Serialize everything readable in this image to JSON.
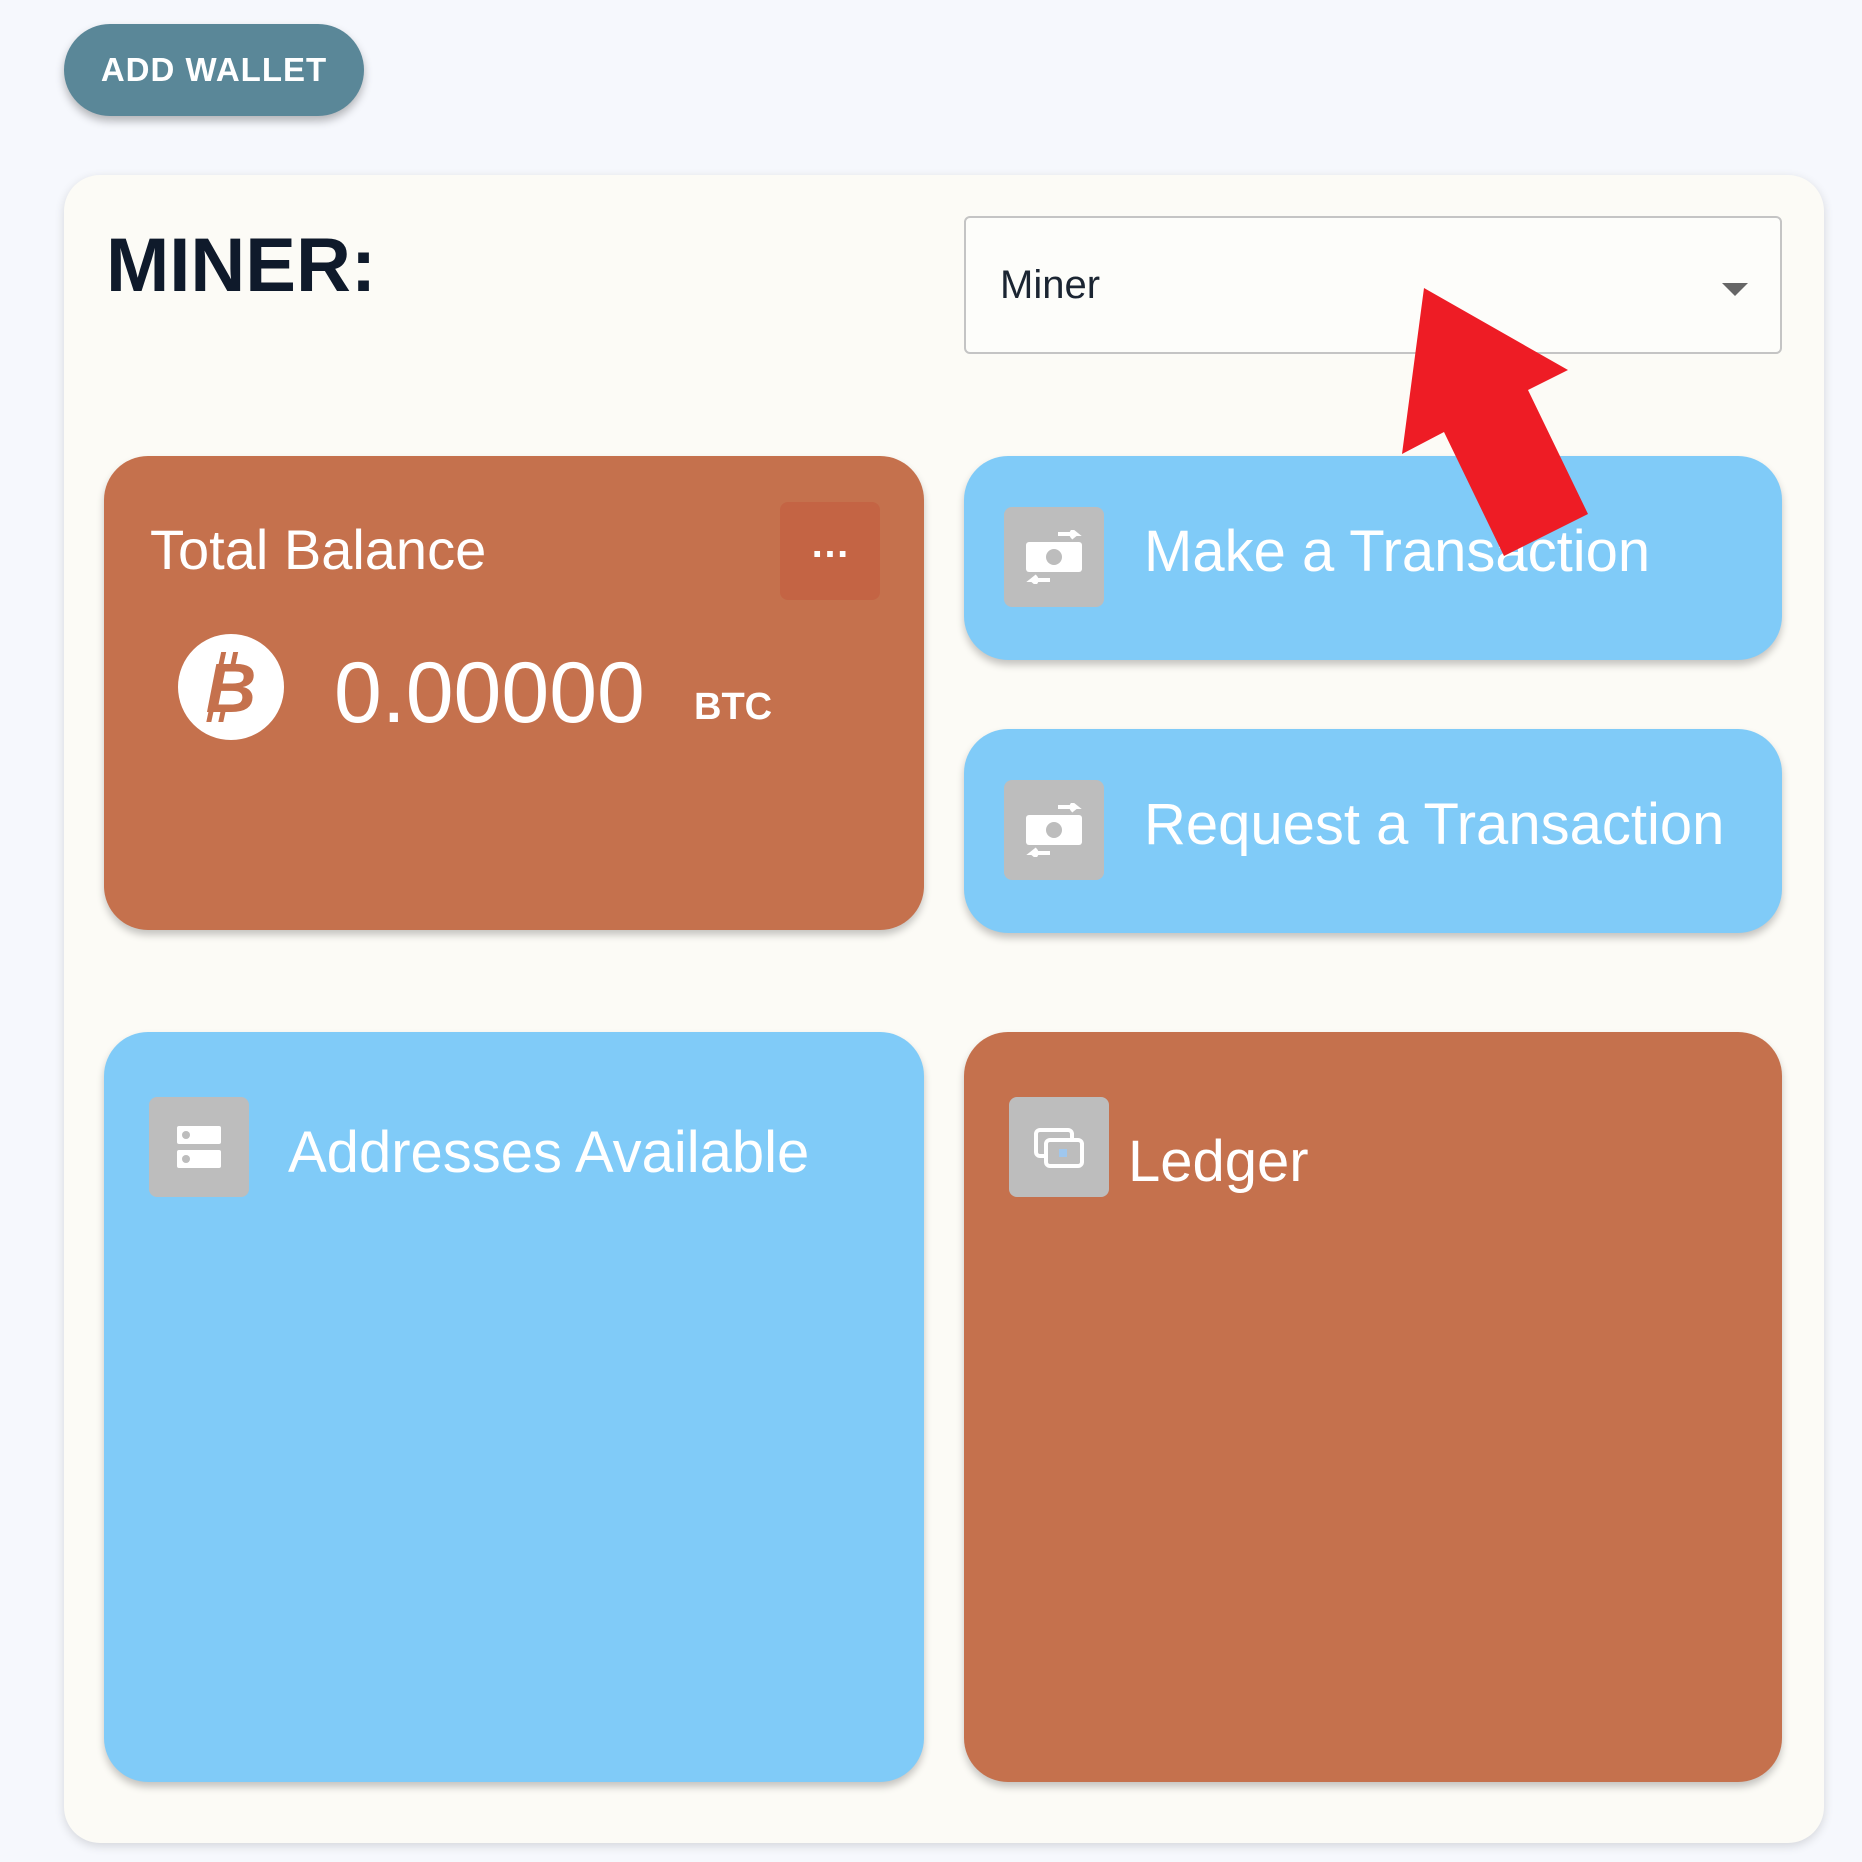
{
  "toolbar": {
    "add_wallet_label": "ADD WALLET"
  },
  "wallet": {
    "title": "MINER:",
    "selector": {
      "selected_value": "Miner"
    }
  },
  "cards": {
    "total_balance": {
      "title": "Total Balance",
      "amount": "0.00000",
      "unit": "BTC",
      "menu_icon": "more-horizontal-icon",
      "coin_icon": "bitcoin-icon"
    },
    "make_transaction": {
      "title": "Make a Transaction",
      "icon": "money-transfer-icon"
    },
    "request_transaction": {
      "title": "Request a Transaction",
      "icon": "money-transfer-icon"
    },
    "addresses": {
      "title": "Addresses Available",
      "icon": "server-list-icon"
    },
    "ledger": {
      "title": "Ledger",
      "icon": "stacked-cards-icon"
    }
  },
  "colors": {
    "page_bg": "#f6f8fd",
    "panel_bg": "#fcfbf6",
    "add_wallet_bg": "#5a8798",
    "card_orange": "#c5714d",
    "card_blue": "#80cbf8",
    "icon_tile": "#bdbdbd",
    "menu_button": "#c46444",
    "annotation_arrow": "#ee1c25"
  }
}
